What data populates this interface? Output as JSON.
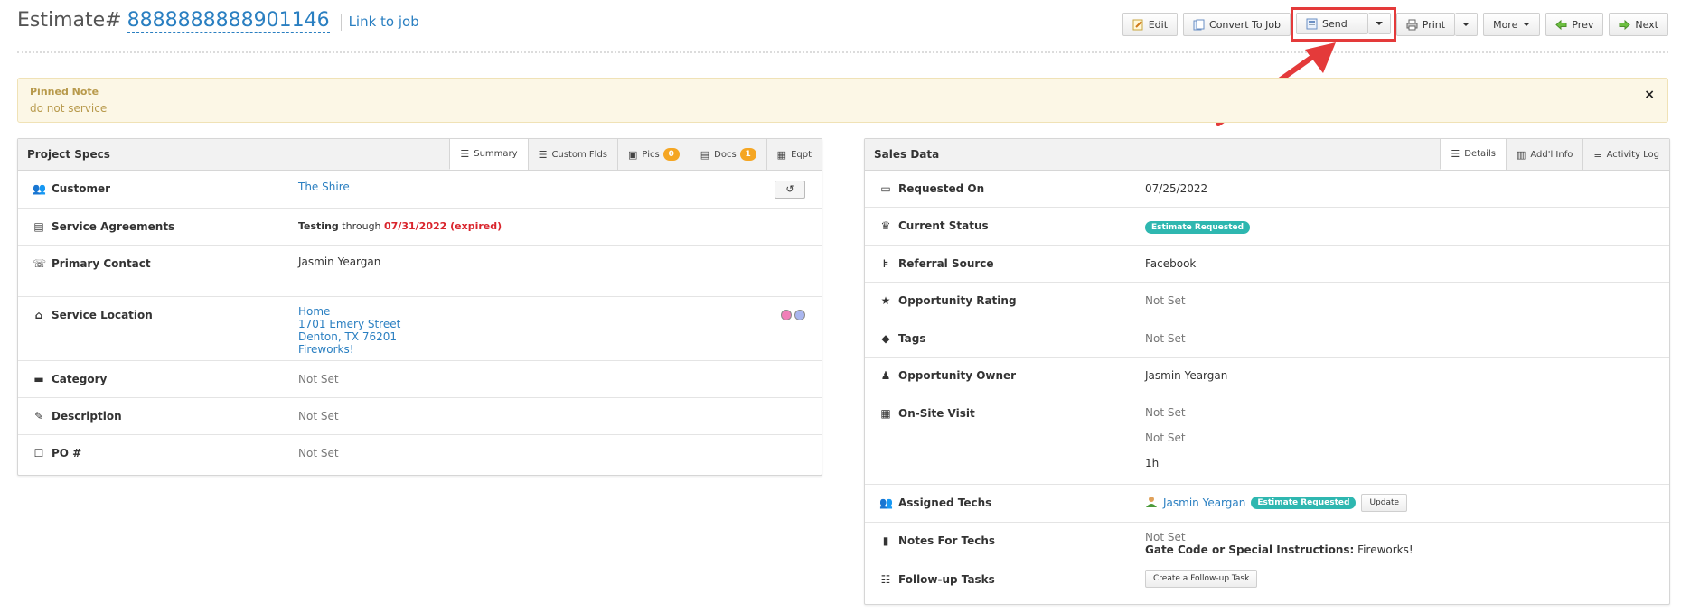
{
  "header": {
    "prefix": "Estimate#",
    "number": "8888888888901146",
    "link_job": "Link to job"
  },
  "toolbar": {
    "edit": "Edit",
    "convert": "Convert To Job",
    "send": "Send",
    "print": "Print",
    "more": "More",
    "prev": "Prev",
    "next": "Next"
  },
  "pinned": {
    "title": "Pinned Note",
    "text": "do not service",
    "close": "×"
  },
  "project_specs": {
    "title": "Project Specs",
    "tabs": {
      "summary": "Summary",
      "custom": "Custom Flds",
      "pics": "Pics",
      "pics_count": "0",
      "docs": "Docs",
      "docs_count": "1",
      "eqpt": "Eqpt"
    },
    "rows": {
      "customer_label": "Customer",
      "customer_value": "The Shire",
      "agreements_label": "Service Agreements",
      "agreements_name": "Testing",
      "agreements_through": "through",
      "agreements_date": "07/31/2022 (expired)",
      "contact_label": "Primary Contact",
      "contact_value": "Jasmin Yeargan",
      "location_label": "Service Location",
      "location_name": "Home",
      "location_street": "1701 Emery Street",
      "location_city": "Denton, TX 76201",
      "location_extra": "Fireworks!",
      "category_label": "Category",
      "category_value": "Not Set",
      "description_label": "Description",
      "description_value": "Not Set",
      "po_label": "PO #",
      "po_value": "Not Set"
    }
  },
  "sales_data": {
    "title": "Sales Data",
    "tabs": {
      "details": "Details",
      "addl": "Add'l Info",
      "activity": "Activity Log"
    },
    "rows": {
      "requested_label": "Requested On",
      "requested_value": "07/25/2022",
      "status_label": "Current Status",
      "status_value": "Estimate Requested",
      "referral_label": "Referral Source",
      "referral_value": "Facebook",
      "rating_label": "Opportunity Rating",
      "rating_value": "Not Set",
      "tags_label": "Tags",
      "tags_value": "Not Set",
      "owner_label": "Opportunity Owner",
      "owner_value": "Jasmin Yeargan",
      "visit_label": "On-Site Visit",
      "visit_value1": "Not Set",
      "visit_value2": "Not Set",
      "visit_value3": "1h",
      "techs_label": "Assigned Techs",
      "techs_name": "Jasmin Yeargan",
      "techs_status": "Estimate Requested",
      "techs_update": "Update",
      "notes_label": "Notes For Techs",
      "notes_value": "Not Set",
      "notes_gate_label": "Gate Code or Special Instructions:",
      "notes_gate_value": "Fireworks!",
      "followup_label": "Follow-up Tasks",
      "followup_button": "Create a Follow-up Task"
    }
  },
  "colors": {
    "accent": "#2a7fc1",
    "highlight": "#e43a3a",
    "status": "#2eb7b0",
    "badge": "#f5a623"
  }
}
